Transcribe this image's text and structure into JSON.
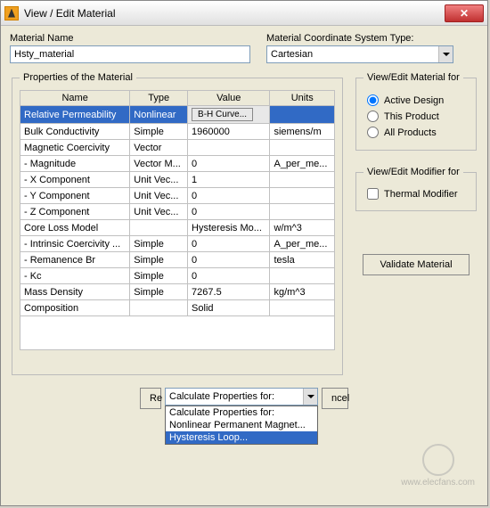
{
  "window": {
    "title": "View / Edit Material",
    "close": "✕"
  },
  "material_name": {
    "label": "Material Name",
    "value": "Hsty_material"
  },
  "coord_system": {
    "label": "Material Coordinate System Type:",
    "value": "Cartesian"
  },
  "props_legend": "Properties of the Material",
  "headers": {
    "name": "Name",
    "type": "Type",
    "value": "Value",
    "units": "Units"
  },
  "rows": [
    {
      "name": "Relative Permeability",
      "type": "Nonlinear",
      "value": "B-H Curve...",
      "units": ""
    },
    {
      "name": "Bulk Conductivity",
      "type": "Simple",
      "value": "1960000",
      "units": "siemens/m"
    },
    {
      "name": "Magnetic Coercivity",
      "type": "Vector",
      "value": "",
      "units": ""
    },
    {
      "name": "- Magnitude",
      "type": "Vector M...",
      "value": "0",
      "units": "A_per_me..."
    },
    {
      "name": "- X Component",
      "type": "Unit Vec...",
      "value": "1",
      "units": ""
    },
    {
      "name": "- Y Component",
      "type": "Unit Vec...",
      "value": "0",
      "units": ""
    },
    {
      "name": "- Z Component",
      "type": "Unit Vec...",
      "value": "0",
      "units": ""
    },
    {
      "name": "Core Loss Model",
      "type": "",
      "value": "Hysteresis Mo...",
      "units": "w/m^3"
    },
    {
      "name": "- Intrinsic Coercivity ...",
      "type": "Simple",
      "value": "0",
      "units": "A_per_me..."
    },
    {
      "name": "- Remanence Br",
      "type": "Simple",
      "value": "0",
      "units": "tesla"
    },
    {
      "name": "- Kc",
      "type": "Simple",
      "value": "0",
      "units": ""
    },
    {
      "name": "Mass Density",
      "type": "Simple",
      "value": "7267.5",
      "units": "kg/m^3"
    },
    {
      "name": "Composition",
      "type": "",
      "value": "Solid",
      "units": ""
    }
  ],
  "view_edit_for": {
    "legend": "View/Edit Material for",
    "options": [
      "Active Design",
      "This Product",
      "All Products"
    ]
  },
  "modifier_for": {
    "legend": "View/Edit Modifier for",
    "option": "Thermal Modifier"
  },
  "validate_btn": "Validate Material",
  "calc_dropdown": {
    "label": "Calculate Properties for:",
    "options": [
      "Calculate Properties for:",
      "Nonlinear Permanent Magnet...",
      "Hysteresis Loop..."
    ]
  },
  "bottom_buttons": {
    "re": "Re",
    "ncel": "ncel"
  },
  "watermark": "www.elecfans.com"
}
